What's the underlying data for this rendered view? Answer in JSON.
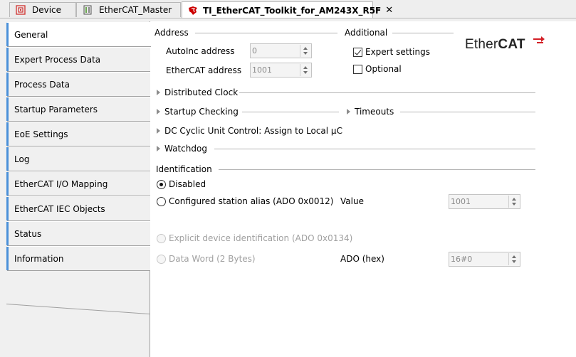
{
  "tabs": [
    {
      "label": "Device",
      "icon": "device-icon",
      "active": false
    },
    {
      "label": "EtherCAT_Master",
      "icon": "ethercat-master-icon",
      "active": false
    },
    {
      "label": "TI_EtherCAT_Toolkit_for_AM243X_R5F",
      "icon": "ti-logo-icon",
      "active": true
    }
  ],
  "nav": {
    "items": [
      {
        "label": "General",
        "active": true
      },
      {
        "label": "Expert Process Data"
      },
      {
        "label": "Process Data"
      },
      {
        "label": "Startup Parameters"
      },
      {
        "label": "EoE Settings"
      },
      {
        "label": "Log"
      },
      {
        "label": "EtherCAT I/O Mapping"
      },
      {
        "label": "EtherCAT IEC Objects"
      },
      {
        "label": "Status"
      },
      {
        "label": "Information"
      }
    ]
  },
  "address": {
    "title": "Address",
    "autoinc_label": "AutoInc address",
    "autoinc_value": "0",
    "ethercat_label": "EtherCAT address",
    "ethercat_value": "1001"
  },
  "additional": {
    "title": "Additional",
    "expert_settings_label": "Expert settings",
    "expert_settings_checked": true,
    "optional_label": "Optional",
    "optional_checked": false
  },
  "logo": {
    "prefix": "Ether",
    "bold": "CAT"
  },
  "sections": {
    "distributed_clock": "Distributed Clock",
    "startup_checking": "Startup Checking",
    "timeouts": "Timeouts",
    "dc_cyclic": "DC Cyclic Unit Control: Assign to Local µC",
    "watchdog": "Watchdog"
  },
  "identification": {
    "title": "Identification",
    "disabled_label": "Disabled",
    "configured_alias_label": "Configured station alias (ADO 0x0012)",
    "value_label": "Value",
    "value": "1001",
    "explicit_label": "Explicit device identification (ADO 0x0134)",
    "data_word_label": "Data Word (2 Bytes)",
    "ado_label": "ADO (hex)",
    "ado_value": "16#0"
  },
  "colors": {
    "accent": "#4a90d9",
    "ti_red": "#cc0000",
    "logo_red": "#d31f26"
  }
}
